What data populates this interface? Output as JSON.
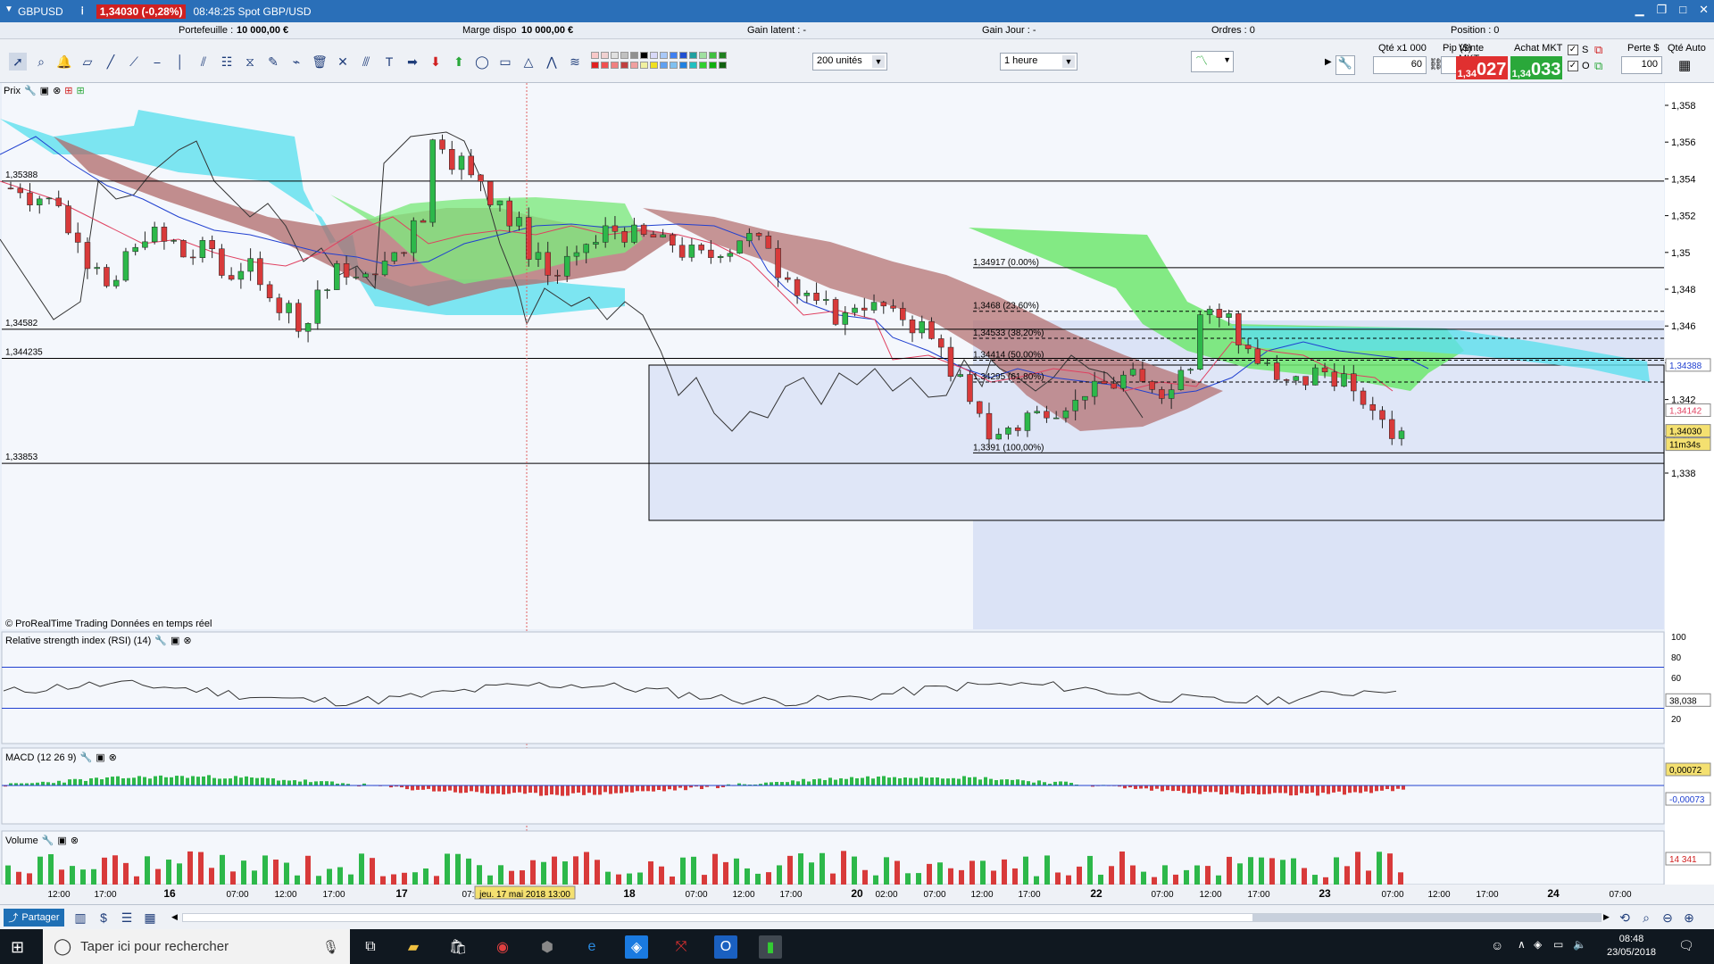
{
  "title": {
    "symbol": "GBPUSD",
    "price_change": "1,34030 (-0,28%)",
    "time_name": "08:48:25 Spot GBP/USD"
  },
  "info": {
    "portefeuille_label": "Portefeuille :",
    "portefeuille_value": "10 000,00 €",
    "marge_label": "Marge dispo",
    "marge_value": "10 000,00 €",
    "gain_latent": "Gain latent : -",
    "gain_jour": "Gain Jour : -",
    "ordres": "Ordres : 0",
    "position": "Position : 0"
  },
  "toolbar": {
    "units": "200 unités",
    "timeframe": "1 heure"
  },
  "order": {
    "qty_label": "Qté x1 000",
    "qty_value": "60",
    "pip_label": "Pip ($)",
    "pip_value": "6",
    "sell_label": "Vente MKT",
    "sell_small": "1,34",
    "sell_big": "027",
    "buy_label": "Achat MKT",
    "buy_small": "1,34",
    "buy_big": "033",
    "s_label": "S",
    "o_label": "O",
    "perte_label": "Perte $",
    "perte_value": "100",
    "qte_auto": "Qté Auto"
  },
  "panels": {
    "price": "Prix",
    "rsi": "Relative strength index (RSI) (14)",
    "macd": "MACD (12 26 9)",
    "volume": "Volume"
  },
  "watermark": "© ProRealTime Trading  Données en temps réel",
  "price_axis": [
    "1,358",
    "1,356",
    "1,354",
    "1,352",
    "1,35",
    "1,348",
    "1,346",
    "1,344",
    "1,342",
    "1,34",
    "1,338"
  ],
  "hlines": [
    "1,35388",
    "1,34582",
    "1,344235",
    "1,33853"
  ],
  "fibo": [
    "1,34917 (0.00%)",
    "1,3468 (23,60%)",
    "1,34533 (38,20%)",
    "1,34414 (50,00%)",
    "1,34295 (61,80%)",
    "1,3391 (100,00%)"
  ],
  "right_tags": {
    "tag1": "1,34388",
    "tag2": "1,34142",
    "tag3": "1,34030",
    "countdown": "11m34s"
  },
  "rsi_axis": [
    "100",
    "80",
    "60",
    "40",
    "20"
  ],
  "rsi_value": "38,038",
  "macd_tags": [
    "0,00072",
    "-0,00073"
  ],
  "volume_tag": "14 341",
  "time_axis": [
    "12:00",
    "17:00",
    "16",
    "07:00",
    "12:00",
    "17:00",
    "17",
    "07:00",
    "jeu. 17 mai 2018 13:00",
    "18",
    "07:00",
    "12:00",
    "17:00",
    "20",
    "02:00",
    "07:00",
    "12:00",
    "17:00",
    "22",
    "07:00",
    "12:00",
    "17:00",
    "23",
    "07:00",
    "12:00",
    "17:00",
    "24",
    "07:00"
  ],
  "bottom": {
    "share": "Partager"
  },
  "taskbar": {
    "search": "Taper ici pour rechercher",
    "clock_time": "08:48",
    "clock_date": "23/05/2018"
  },
  "colors": {
    "title_blue": "#2a6fb8",
    "up_candle": "#2db84a",
    "down_candle": "#d83a3a",
    "cloud_green": "#7ee87e",
    "cloud_red": "#b06a6a",
    "cyan": "#5ee0ee",
    "sell": "#e03030",
    "buy": "#2aa83a"
  }
}
